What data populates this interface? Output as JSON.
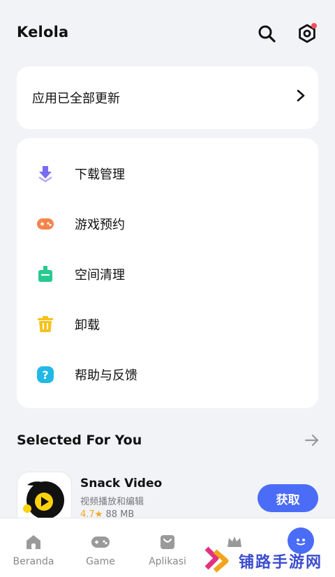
{
  "header": {
    "title": "Kelola"
  },
  "update": {
    "text": "应用已全部更新"
  },
  "menu": [
    {
      "label": "下载管理",
      "icon": "download-icon",
      "color": "#7a6cf2"
    },
    {
      "label": "游戏预约",
      "icon": "gamepad-icon",
      "color": "#f5844a"
    },
    {
      "label": "空间清理",
      "icon": "cleanup-icon",
      "color": "#27c98f"
    },
    {
      "label": "卸载",
      "icon": "trash-icon",
      "color": "#f7c21a"
    },
    {
      "label": "帮助与反馈",
      "icon": "help-icon",
      "color": "#22b8e6"
    }
  ],
  "selected": {
    "title": "Selected For You",
    "app": {
      "name": "Snack Video",
      "desc": "视频播放和编辑",
      "rating": "4.7★",
      "size": "88 MB",
      "button": "获取"
    }
  },
  "nav": [
    {
      "label": "Beranda",
      "icon": "home-icon"
    },
    {
      "label": "Game",
      "icon": "game-icon"
    },
    {
      "label": "Aplikasi",
      "icon": "apps-bag-icon"
    },
    {
      "label": "",
      "icon": "crown-icon"
    },
    {
      "label": "",
      "icon": "me-icon"
    }
  ],
  "watermark": {
    "text": "铺路手游网"
  },
  "colors": {
    "accent": "#4a6cf7",
    "background": "#f1f3f7",
    "badge": "#f0505a"
  }
}
